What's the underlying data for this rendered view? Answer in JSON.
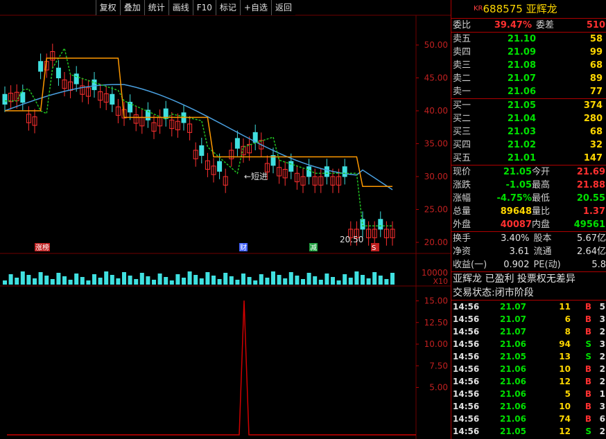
{
  "toolbar": {
    "items": [
      "复权",
      "叠加",
      "统计",
      "画线",
      "F10",
      "标记",
      "+自选",
      "返回"
    ]
  },
  "chart_data": {
    "type": "candlestick",
    "price_axis": {
      "ticks": [
        "50.00",
        "45.00",
        "40.00",
        "35.00",
        "30.00",
        "25.00",
        "20.00"
      ],
      "values": [
        50,
        45,
        40,
        35,
        30,
        25,
        20
      ]
    },
    "volume_axis": {
      "ticks": [
        "10000"
      ],
      "multiplier": "X10"
    },
    "indicator_axis": {
      "ticks": [
        "15.00",
        "12.50",
        "10.00",
        "7.50",
        "5.00"
      ],
      "values": [
        15,
        12.5,
        10,
        7.5,
        5
      ]
    },
    "annotations": {
      "short_entry": "←短进",
      "low_marker": "20.50"
    },
    "event_markers": [
      "涨榜",
      "财",
      "减",
      "S"
    ],
    "colors": {
      "up": "#ff3030",
      "down": "#40e0e0",
      "ma_orange": "#ff9900",
      "ma_blue": "#4aa0e0",
      "ma_green": "#20c020",
      "indicator": "#d00000",
      "grid": "#700000"
    }
  },
  "header": {
    "market": "KR",
    "code": "688575",
    "name": "亚辉龙"
  },
  "quote": {
    "ratio_label": "委比",
    "ratio": "39.47%",
    "diff_label": "委差",
    "diff": "510",
    "asks": [
      {
        "label": "卖五",
        "price": "21.10",
        "vol": "58"
      },
      {
        "label": "卖四",
        "price": "21.09",
        "vol": "99"
      },
      {
        "label": "卖三",
        "price": "21.08",
        "vol": "68"
      },
      {
        "label": "卖二",
        "price": "21.07",
        "vol": "89"
      },
      {
        "label": "卖一",
        "price": "21.06",
        "vol": "77"
      }
    ],
    "bids": [
      {
        "label": "买一",
        "price": "21.05",
        "vol": "374"
      },
      {
        "label": "买二",
        "price": "21.04",
        "vol": "280"
      },
      {
        "label": "买三",
        "price": "21.03",
        "vol": "68"
      },
      {
        "label": "买四",
        "price": "21.02",
        "vol": "32"
      },
      {
        "label": "买五",
        "price": "21.01",
        "vol": "147"
      }
    ],
    "stats": [
      {
        "l1": "现价",
        "v1": "21.05",
        "c1": "g",
        "l2": "今开",
        "v2": "21.69",
        "c2": "r"
      },
      {
        "l1": "涨跌",
        "v1": "-1.05",
        "c1": "g",
        "l2": "最高",
        "v2": "21.88",
        "c2": "r"
      },
      {
        "l1": "涨幅",
        "v1": "-4.75%",
        "c1": "g",
        "l2": "最低",
        "v2": "20.55",
        "c2": "g"
      },
      {
        "l1": "总量",
        "v1": "89648",
        "c1": "y",
        "l2": "量比",
        "v2": "1.37",
        "c2": "r"
      },
      {
        "l1": "外盘",
        "v1": "40087",
        "c1": "r",
        "l2": "内盘",
        "v2": "49561",
        "c2": "g"
      }
    ],
    "fund": [
      {
        "l1": "换手",
        "v1": "3.40%",
        "l2": "股本",
        "v2": "5.67亿"
      },
      {
        "l1": "净资",
        "v1": "3.61",
        "l2": "流通",
        "v2": "2.64亿"
      },
      {
        "l1": "收益(一)",
        "v1": "0.902",
        "l2": "PE(动)",
        "v2": "5.8"
      }
    ],
    "desc": "亚辉龙 已盈利 投票权无差异",
    "status": "交易状态:闭市阶段"
  },
  "ticks": [
    {
      "t": "14:56",
      "p": "21.07",
      "v": "11",
      "s": "B",
      "n": "5"
    },
    {
      "t": "14:56",
      "p": "21.07",
      "v": "6",
      "s": "B",
      "n": "3"
    },
    {
      "t": "14:56",
      "p": "21.07",
      "v": "8",
      "s": "B",
      "n": "2"
    },
    {
      "t": "14:56",
      "p": "21.06",
      "v": "94",
      "s": "S",
      "n": "3"
    },
    {
      "t": "14:56",
      "p": "21.05",
      "v": "13",
      "s": "S",
      "n": "2"
    },
    {
      "t": "14:56",
      "p": "21.06",
      "v": "10",
      "s": "B",
      "n": "2"
    },
    {
      "t": "14:56",
      "p": "21.06",
      "v": "12",
      "s": "B",
      "n": "2"
    },
    {
      "t": "14:56",
      "p": "21.06",
      "v": "5",
      "s": "B",
      "n": "1"
    },
    {
      "t": "14:56",
      "p": "21.06",
      "v": "10",
      "s": "B",
      "n": "3"
    },
    {
      "t": "14:56",
      "p": "21.06",
      "v": "74",
      "s": "B",
      "n": "6"
    },
    {
      "t": "14:56",
      "p": "21.05",
      "v": "12",
      "s": "S",
      "n": "2"
    }
  ]
}
